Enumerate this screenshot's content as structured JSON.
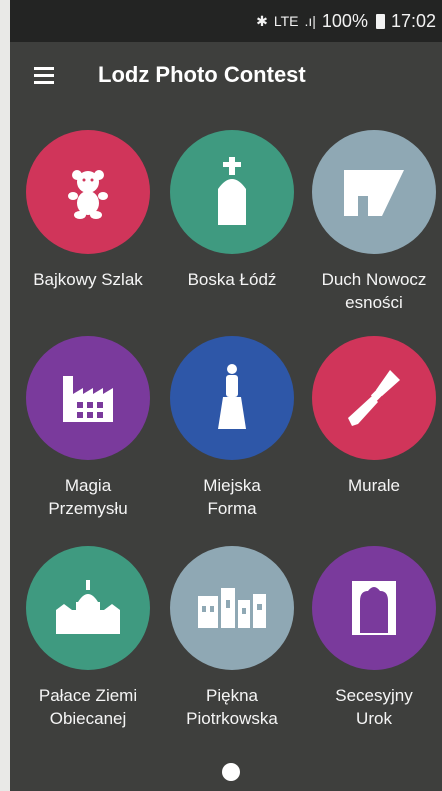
{
  "status": {
    "bluetooth": "✱",
    "network": "LTE",
    "signal": ".ı|",
    "battery": "100%",
    "time": "17:02"
  },
  "appbar": {
    "title": "Lodz Photo Contest"
  },
  "colors": {
    "red": "#d0355a",
    "teal": "#3f9a80",
    "gray": "#8fa8b4",
    "purple": "#7a3a9c",
    "blue": "#2e57a8"
  },
  "tiles": [
    {
      "label": "Bajkowy Szlak",
      "icon": "teddy-bear-icon"
    },
    {
      "label": "Boska Łódź",
      "icon": "church-icon"
    },
    {
      "label": "Duch Nowocz\nesności",
      "icon": "modern-building-icon"
    },
    {
      "label": "Magia\nPrzemysłu",
      "icon": "factory-icon"
    },
    {
      "label": "Miejska\nForma",
      "icon": "monument-icon"
    },
    {
      "label": "Murale",
      "icon": "paint-brush-icon"
    },
    {
      "label": "Pałace Ziemi\nObiecanej",
      "icon": "palace-icon"
    },
    {
      "label": "Piękna\nPiotrkowska",
      "icon": "street-buildings-icon"
    },
    {
      "label": "Secesyjny\nUrok",
      "icon": "art-nouveau-door-icon"
    }
  ],
  "pager": {
    "current": 1
  }
}
